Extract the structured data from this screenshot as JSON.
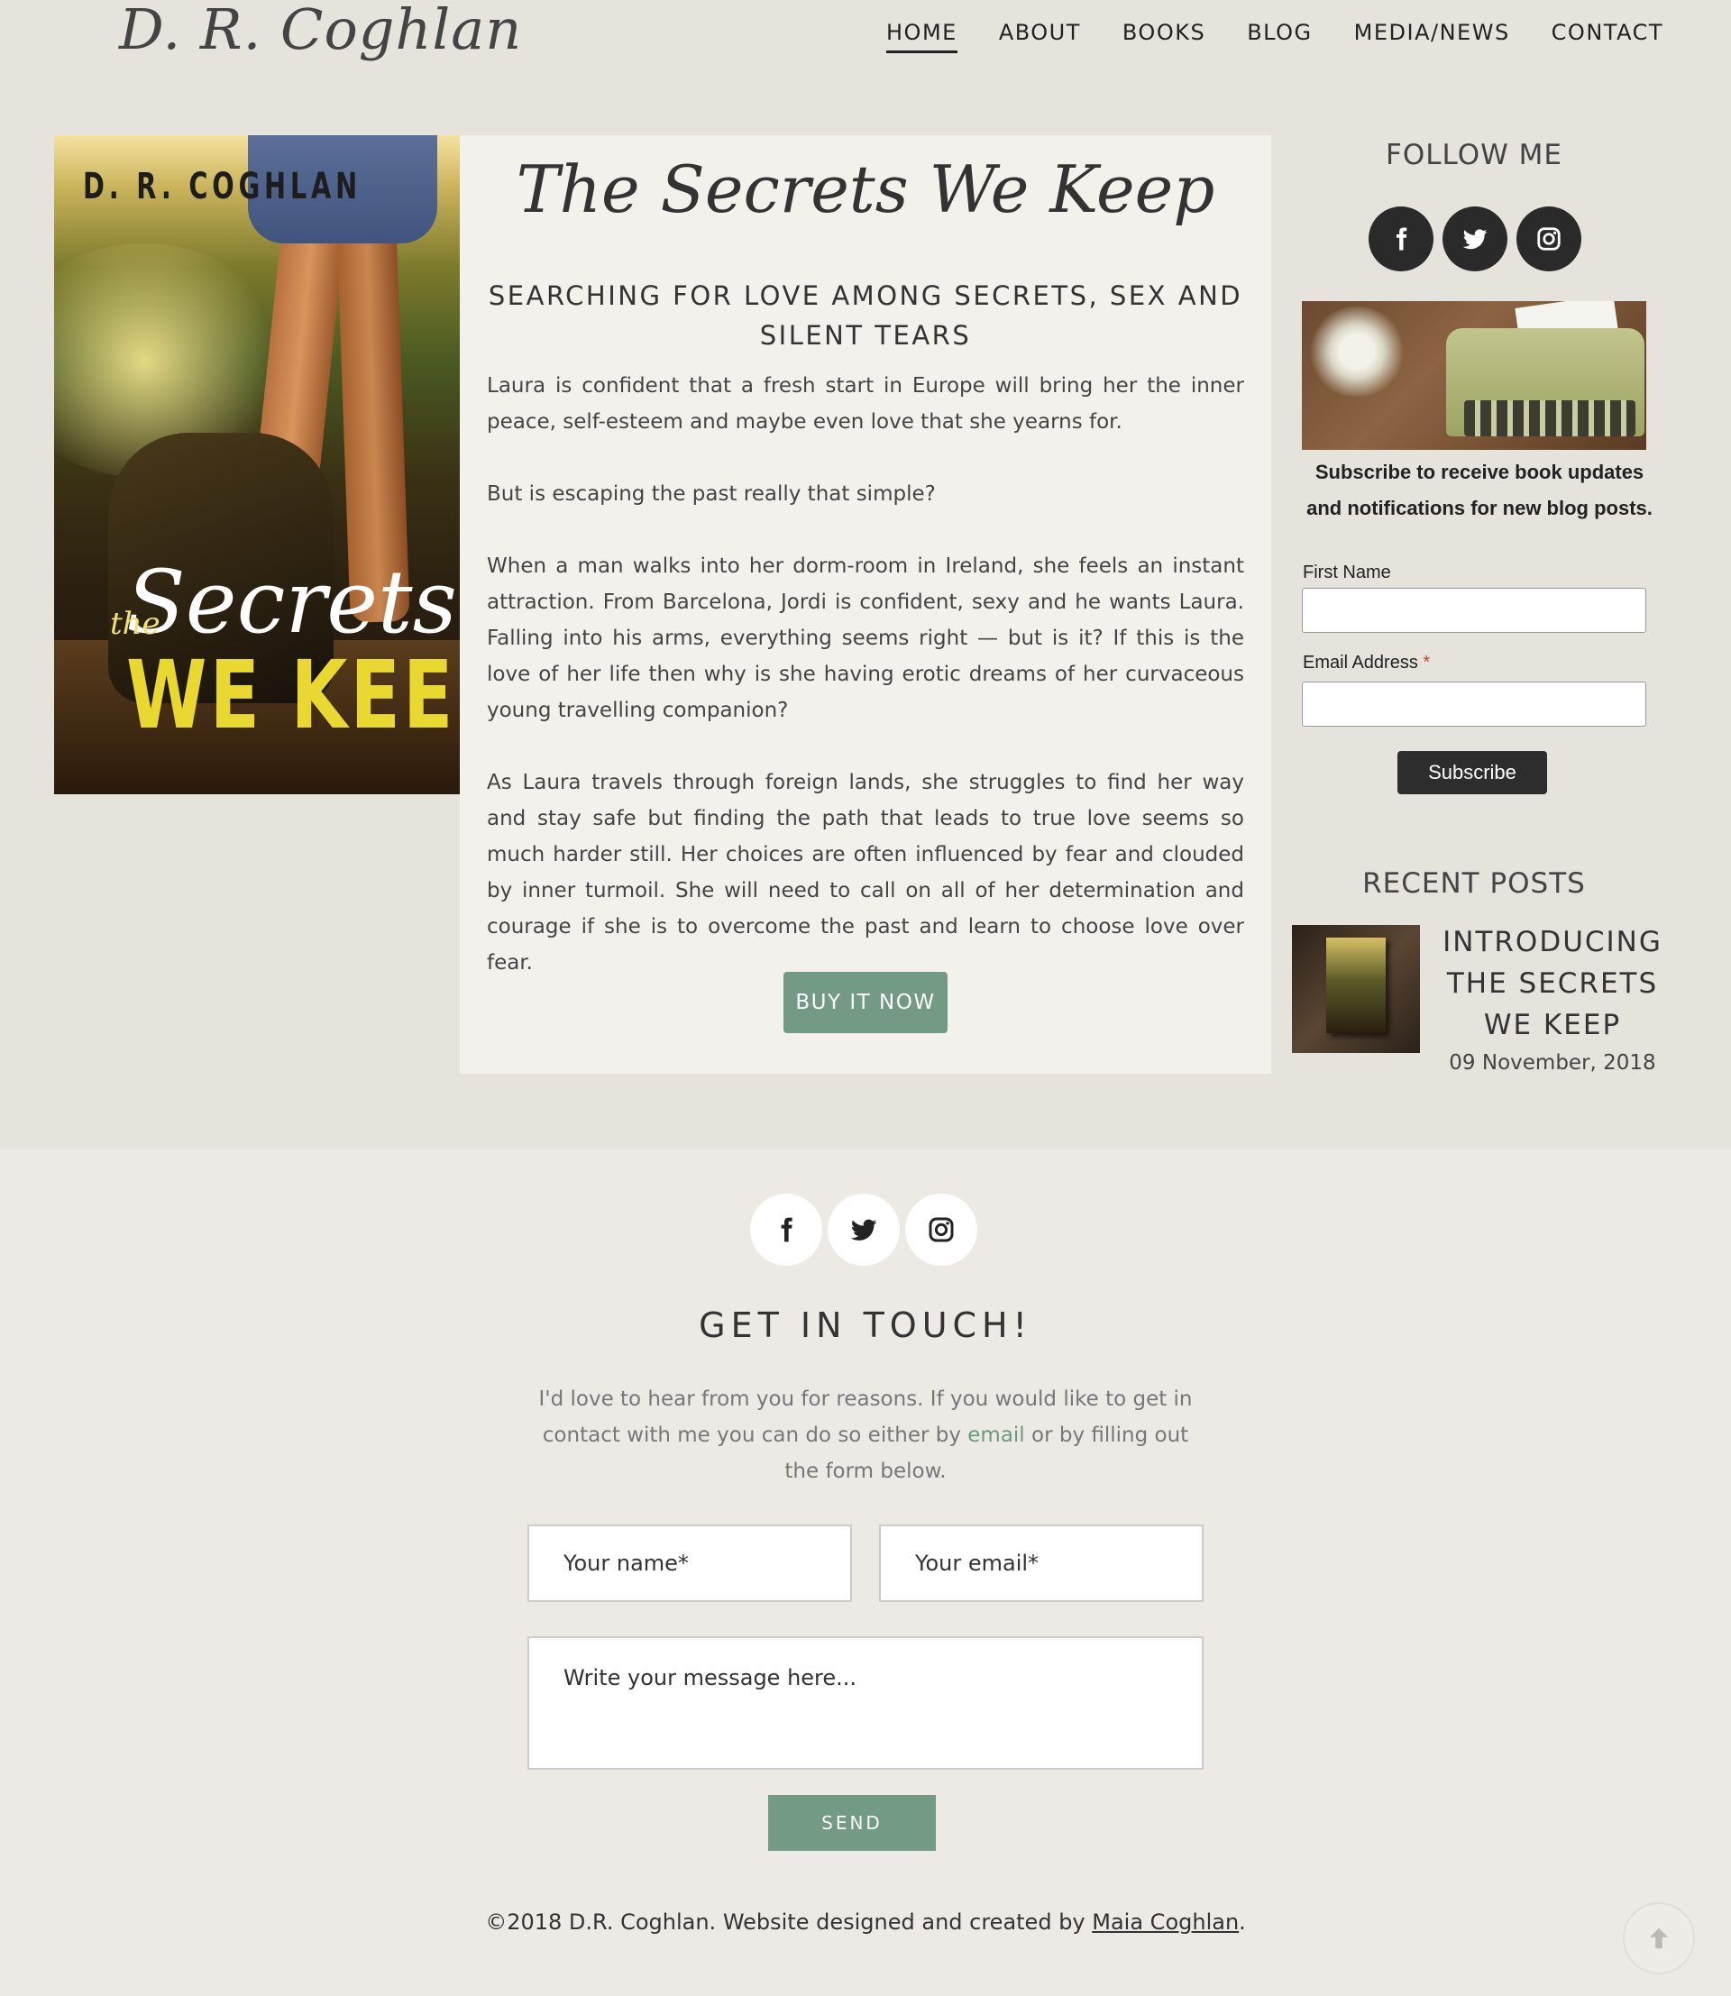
{
  "header": {
    "logo": "D. R. Coghlan",
    "nav": [
      "HOME",
      "ABOUT",
      "BOOKS",
      "BLOG",
      "MEDIA/NEWS",
      "CONTACT"
    ],
    "active": "HOME"
  },
  "book": {
    "cover_author": "D. R. COGHLAN",
    "cover_the": "the",
    "cover_secrets": "Secrets",
    "cover_we_keep": "WE KEEP",
    "title": "The Secrets We Keep",
    "tagline": "SEARCHING FOR LOVE AMONG SECRETS, SEX AND SILENT TEARS",
    "paragraphs": [
      "Laura is confident that a fresh start in Europe will bring her the inner peace, self-esteem and maybe even love that she yearns for.",
      "But is escaping the past really that simple?",
      "When a man walks into her dorm-room in Ireland, she feels an instant attraction. From Barcelona, Jordi is confident, sexy and he wants Laura. Falling into his arms, everything seems right — but is it? If this is the love of her life then why is she having erotic dreams of her curvaceous young travelling companion?",
      "As Laura travels through foreign lands, she struggles to find her way and stay safe but finding the path that leads to true love seems so much harder still. Her choices are often influenced by fear and clouded by inner turmoil. She will need to call on all of her determination and courage if she is to overcome the past and learn to choose love over fear."
    ],
    "buy_label": "BUY IT NOW"
  },
  "sidebar": {
    "follow_title": "FOLLOW ME",
    "subscribe_text": "Subscribe to receive book updates and notifications for new blog posts.",
    "first_name_label": "First Name",
    "email_label": "Email Address",
    "required_mark": "*",
    "first_name_value": "",
    "email_value": "",
    "subscribe_label": "Subscribe",
    "recent_title": "RECENT POSTS",
    "post": {
      "title": "INTRODUCING THE SECRETS WE KEEP",
      "date": "09 November, 2018"
    }
  },
  "footer": {
    "title": "GET IN TOUCH!",
    "text_before": "I'd love to hear from you for reasons. If you would like to get in contact with me you can do so either by",
    "email_link": "email",
    "text_after": "or by filling out the form below.",
    "name_placeholder": "Your name*",
    "email_placeholder": "Your email*",
    "message_placeholder": "Write your message here...",
    "send_label": "SEND",
    "copyright_prefix": "©2018 D.R. Coghlan. Website designed and created by",
    "designer": "Maia Coghlan",
    "copyright_suffix": "."
  },
  "icons": [
    "facebook-icon",
    "twitter-icon",
    "instagram-icon",
    "arrow-up-icon"
  ],
  "colors": {
    "accent_green": "#739a85",
    "background": "#e6e2dc",
    "panel": "#f3f1ec",
    "dark_button": "#2d2d2d"
  }
}
